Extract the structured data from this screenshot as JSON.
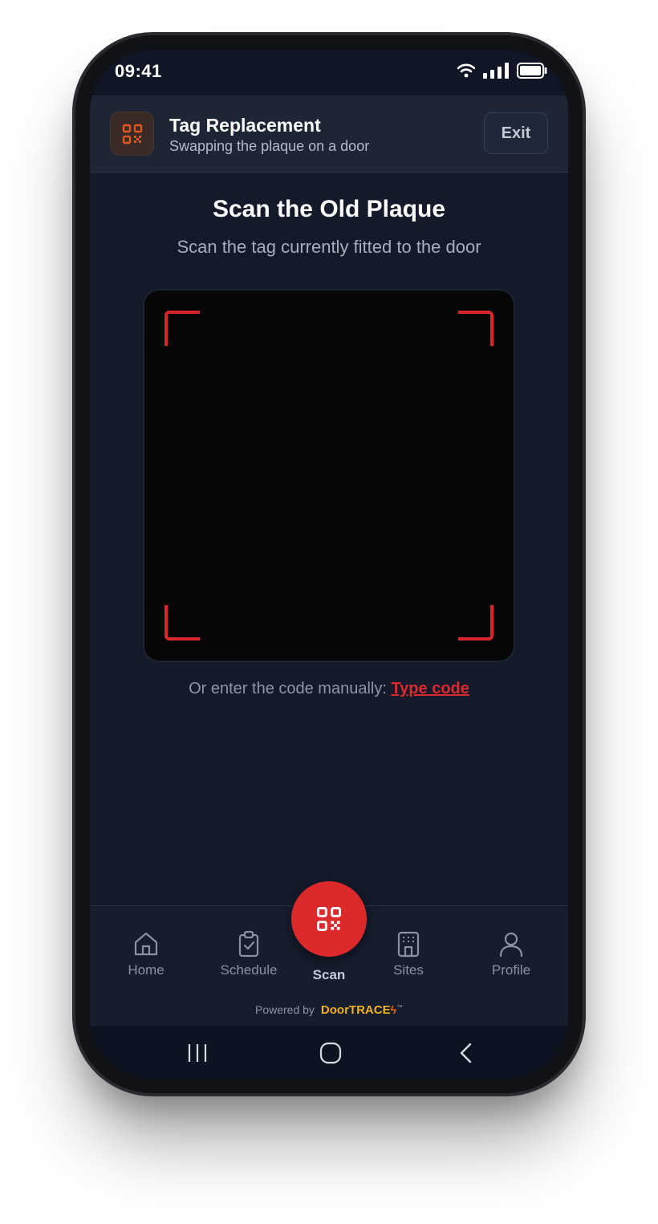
{
  "status_bar": {
    "time": "09:41"
  },
  "header": {
    "title": "Tag Replacement",
    "subtitle": "Swapping the plaque on a door",
    "exit_label": "Exit",
    "icon": "qr-code-icon"
  },
  "main": {
    "title": "Scan the Old Plaque",
    "subtitle": "Scan the tag currently fitted to the door",
    "manual_prefix": "Or enter the code manually:",
    "manual_link": "Type code"
  },
  "bottom_nav": {
    "items": [
      {
        "label": "Home",
        "icon": "home-icon"
      },
      {
        "label": "Schedule",
        "icon": "clipboard-check-icon"
      },
      {
        "label": "Scan",
        "icon": "qr-code-icon"
      },
      {
        "label": "Sites",
        "icon": "building-icon"
      },
      {
        "label": "Profile",
        "icon": "user-icon"
      }
    ],
    "powered_by": "Powered by",
    "brand": "DoorTRACE",
    "trademark": "™"
  },
  "colors": {
    "accent": "#dc2a2c",
    "background": "#141a2a",
    "header": "#1e2636",
    "brand": "#f2b020"
  }
}
